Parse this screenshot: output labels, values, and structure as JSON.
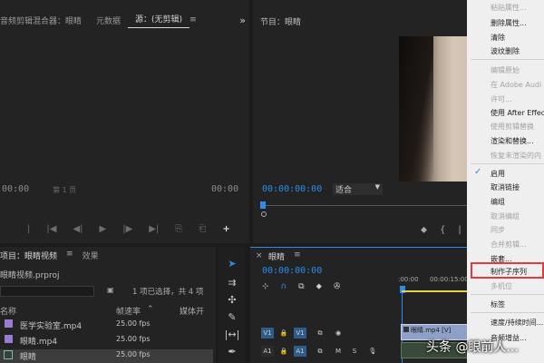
{
  "source_panel": {
    "tabs": [
      "音频剪辑混合器：眼睛",
      "元数据",
      "源：(无剪辑)"
    ],
    "timecode_left": "00:00",
    "page_label": "第 1 页",
    "timecode_right": "00:00"
  },
  "program_panel": {
    "title": "节目：眼睛",
    "timecode": "00:00:00:00",
    "fit": "适合"
  },
  "project_panel": {
    "tabs": [
      "项目：眼睛视频",
      "效果"
    ],
    "project_file": "眼睛视频.prproj",
    "selection_info": "1 项已选择，共 4 项",
    "columns": [
      "名称",
      "帧速率",
      "媒体开"
    ],
    "items": [
      {
        "name": "医学实验室.mp4",
        "fps": "25.00 fps"
      },
      {
        "name": "眼睛.mp4",
        "fps": "25.00 fps"
      },
      {
        "name": "眼睛",
        "fps": "25.00 fps"
      }
    ]
  },
  "timeline": {
    "title": "眼睛",
    "timecode": "00:00:00:00",
    "ruler": [
      ":00:00",
      "00:00:15:00"
    ],
    "tracks": {
      "v1": "V1",
      "a1": "A1",
      "m": "M",
      "s": "S"
    },
    "clip_label": "眼睛.mp4 [V]"
  },
  "context_menu": {
    "items": [
      {
        "label": "粘贴属性...",
        "enabled": false
      },
      {
        "label": "删除属性...",
        "enabled": true
      },
      {
        "label": "清除",
        "enabled": true
      },
      {
        "label": "波纹删除",
        "enabled": true
      },
      {
        "label": "编辑原始",
        "enabled": false
      },
      {
        "label": "在 Adobe Audi",
        "enabled": false
      },
      {
        "label": "许可...",
        "enabled": false
      },
      {
        "label": "使用 After Effec",
        "enabled": true
      },
      {
        "label": "使用剪辑替换",
        "enabled": false
      },
      {
        "label": "渲染和替换...",
        "enabled": true
      },
      {
        "label": "恢复未渲染的内",
        "enabled": false
      },
      {
        "label": "启用",
        "enabled": true,
        "checked": true
      },
      {
        "label": "取消链接",
        "enabled": true
      },
      {
        "label": "编组",
        "enabled": true
      },
      {
        "label": "取消编组",
        "enabled": false
      },
      {
        "label": "同步",
        "enabled": false
      },
      {
        "label": "合并剪辑...",
        "enabled": false
      },
      {
        "label": "嵌套...",
        "enabled": true
      },
      {
        "label": "制作子序列",
        "enabled": true,
        "highlighted": true
      },
      {
        "label": "多机位",
        "enabled": false
      },
      {
        "label": "标签",
        "enabled": true
      },
      {
        "label": "速度/持续时间...",
        "enabled": true
      },
      {
        "label": "音频增益...",
        "enabled": true
      }
    ]
  },
  "watermark": "头条 @眼前人...",
  "colors": {
    "accent": "#2d8ceb",
    "highlight_box": "#e23b3b",
    "clip": "#8fa0c8"
  }
}
